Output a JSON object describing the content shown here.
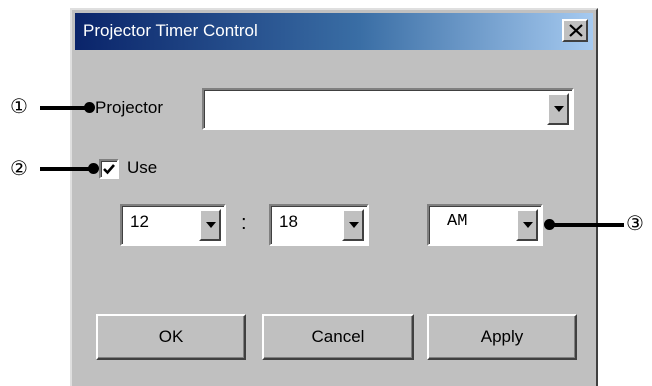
{
  "window": {
    "title": "Projector Timer Control",
    "close_label": "close"
  },
  "projector": {
    "label": "Projector",
    "value": ""
  },
  "use": {
    "label": "Use",
    "checked": true
  },
  "time": {
    "hour": "12",
    "separator": ":",
    "minute": "18",
    "ampm": "AM"
  },
  "buttons": {
    "ok": "OK",
    "cancel": "Cancel",
    "apply": "Apply"
  },
  "callouts": {
    "one": "①",
    "two": "②",
    "three": "③"
  }
}
